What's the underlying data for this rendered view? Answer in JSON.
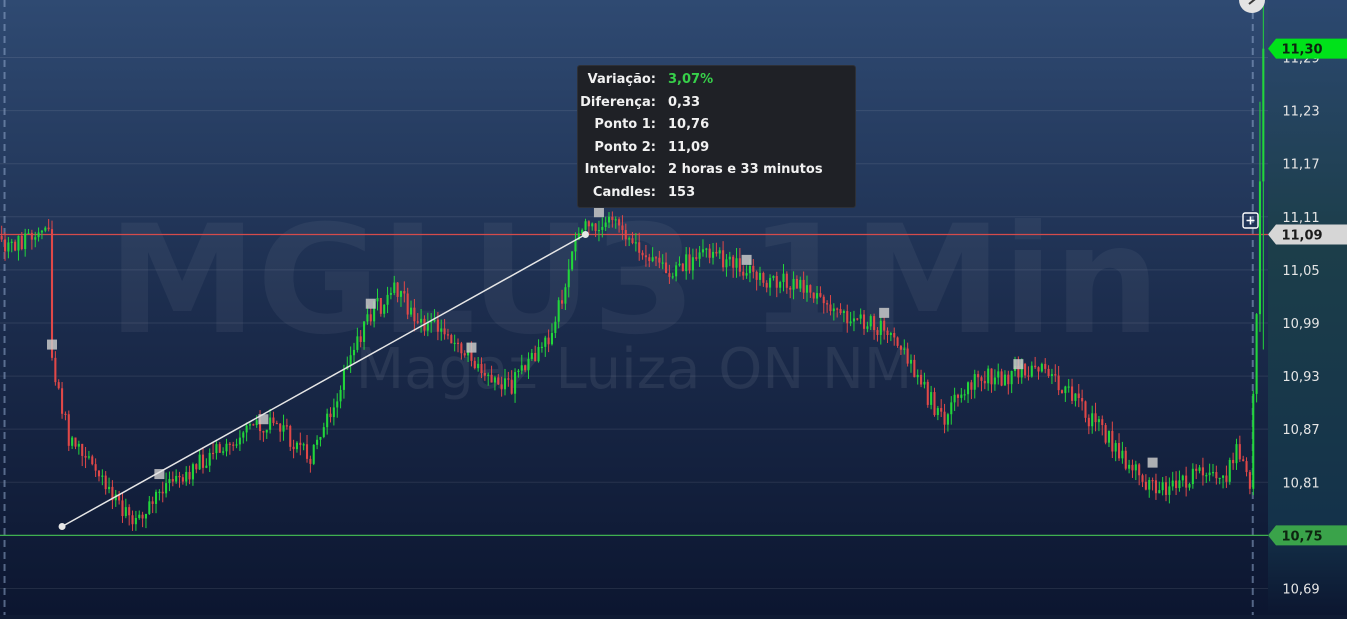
{
  "chart_data": {
    "type": "candlestick",
    "watermark": {
      "symbol": "MGLU3 1Min",
      "name": "Magaz Luiza ON NM"
    },
    "y_axis": {
      "ticks": [
        "11,29",
        "11,23",
        "11,17",
        "11,11",
        "11,05",
        "10,99",
        "10,93",
        "10,87",
        "10,81",
        "10,75",
        "10,69"
      ],
      "ylim": [
        10.66,
        11.355
      ],
      "grid": true
    },
    "price_tags": [
      {
        "label": "11,30",
        "value": 11.3,
        "color": "#00e21a"
      },
      {
        "label": "11,09",
        "value": 11.09,
        "color": "#d6d6d6"
      },
      {
        "label": "10,75",
        "value": 10.75,
        "color": "#3aa34a"
      }
    ],
    "horizontal_lines": [
      {
        "value": 11.09,
        "color": "#d44b4b"
      },
      {
        "value": 10.75,
        "color": "#3fb050"
      }
    ],
    "measure": {
      "point1": 10.76,
      "point2": 11.09,
      "start_index": 18,
      "end_index": 171,
      "tooltip": [
        {
          "label": "Variação:",
          "value": "3,07%",
          "highlight": true
        },
        {
          "label": "Diferença:",
          "value": "0,33",
          "highlight": false
        },
        {
          "label": "Ponto 1:",
          "value": "10,76",
          "highlight": false
        },
        {
          "label": "Ponto 2:",
          "value": "11,09",
          "highlight": false
        },
        {
          "label": "Intervalo:",
          "value": "2 horas e 33 minutos",
          "highlight": false
        },
        {
          "label": "Candles:",
          "value": "153",
          "highlight": false
        }
      ]
    },
    "session_separators": [
      1,
      373
    ],
    "n_candles": 377,
    "keypoints": [
      [
        0,
        11.08
      ],
      [
        14,
        11.09
      ],
      [
        15,
        10.95
      ],
      [
        20,
        10.86
      ],
      [
        30,
        10.81
      ],
      [
        38,
        10.77
      ],
      [
        46,
        10.79
      ],
      [
        58,
        10.83
      ],
      [
        68,
        10.86
      ],
      [
        80,
        10.88
      ],
      [
        92,
        10.84
      ],
      [
        100,
        10.91
      ],
      [
        110,
        11.0
      ],
      [
        118,
        11.03
      ],
      [
        124,
        10.99
      ],
      [
        132,
        10.98
      ],
      [
        142,
        10.94
      ],
      [
        152,
        10.92
      ],
      [
        164,
        10.98
      ],
      [
        172,
        11.09
      ],
      [
        180,
        11.11
      ],
      [
        190,
        11.07
      ],
      [
        200,
        11.05
      ],
      [
        210,
        11.07
      ],
      [
        218,
        11.06
      ],
      [
        228,
        11.04
      ],
      [
        238,
        11.03
      ],
      [
        248,
        11.0
      ],
      [
        260,
        10.99
      ],
      [
        270,
        10.95
      ],
      [
        280,
        10.88
      ],
      [
        290,
        10.93
      ],
      [
        300,
        10.93
      ],
      [
        310,
        10.94
      ],
      [
        320,
        10.9
      ],
      [
        330,
        10.86
      ],
      [
        340,
        10.81
      ],
      [
        348,
        10.8
      ],
      [
        356,
        10.82
      ],
      [
        364,
        10.81
      ],
      [
        368,
        10.85
      ],
      [
        372,
        10.81
      ],
      [
        374,
        11.0
      ],
      [
        376,
        11.3
      ]
    ]
  }
}
